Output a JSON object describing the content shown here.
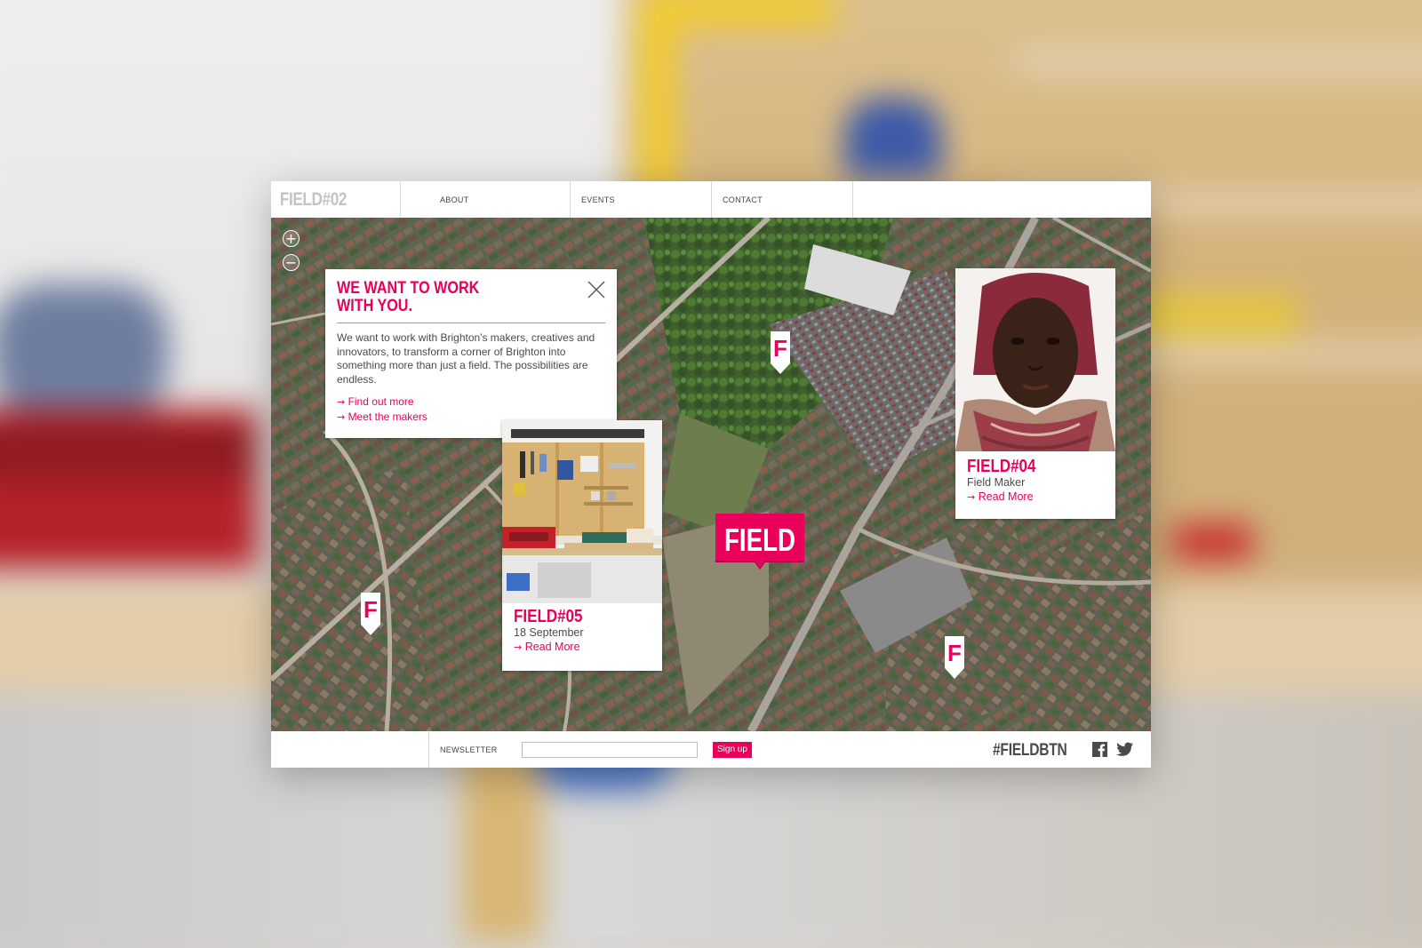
{
  "site": {
    "logo": "FIELD#02",
    "nav": [
      {
        "label": "ABOUT"
      },
      {
        "label": "EVENTS"
      },
      {
        "label": "CONTACT"
      }
    ]
  },
  "map": {
    "zoom_in": "+",
    "zoom_out": "−",
    "center_marker": "FIELD",
    "pin_letter": "F"
  },
  "info_card": {
    "title": "WE WANT TO WORK WITH YOU.",
    "body": "We want to work with Brighton's makers, creatives and innovators, to transform a corner of Brighton into something more than just a field. The possibilities are endless.",
    "links": [
      {
        "arrow": "→",
        "label": "Find out more"
      },
      {
        "arrow": "→",
        "label": "Meet the makers"
      }
    ]
  },
  "event_card": {
    "title": "FIELD#05",
    "subtitle": "18 September",
    "arrow": "→",
    "link": "Read More"
  },
  "maker_card": {
    "title": "FIELD#04",
    "subtitle": "Field Maker",
    "arrow": "→",
    "link": "Read More"
  },
  "footer": {
    "newsletter_label": "NEWSLETTER",
    "newsletter_value": "",
    "signup_label": "Sign up",
    "hashtag": "#FIELDBTN",
    "social_icons": [
      "facebook-icon",
      "twitter-icon"
    ]
  },
  "colors": {
    "accent": "#e8005a",
    "text": "#4a4a4a",
    "divider": "#d8d8d8"
  }
}
